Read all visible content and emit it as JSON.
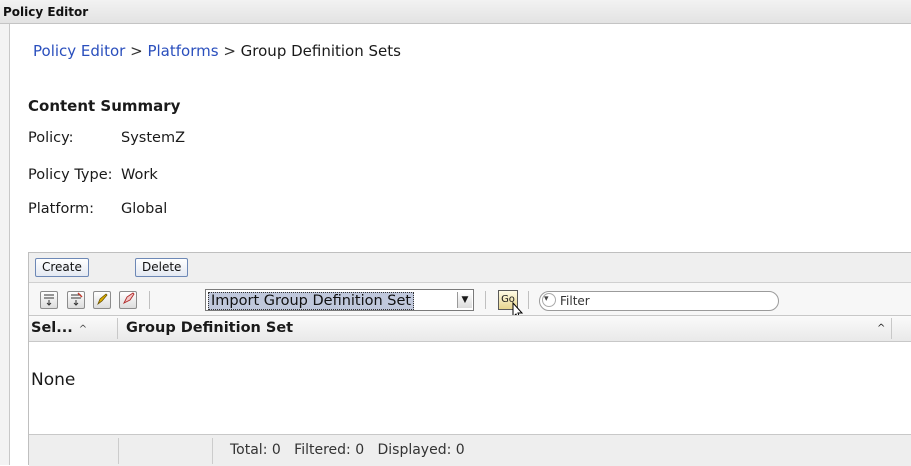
{
  "window": {
    "title": "Policy Editor"
  },
  "breadcrumb": {
    "items": [
      "Policy Editor",
      "Platforms",
      "Group Definition Sets"
    ],
    "separator": ">"
  },
  "summary": {
    "heading": "Content Summary",
    "rows": [
      {
        "label": "Policy:",
        "value": "SystemZ"
      },
      {
        "label": "Policy Type:",
        "value": "Work"
      },
      {
        "label": "Platform:",
        "value": "Global"
      }
    ]
  },
  "toolbar": {
    "create_label": "Create",
    "delete_label": "Delete",
    "action_select": {
      "selected": "Import Group Definition Set"
    },
    "go_label": "Go",
    "filter": {
      "placeholder": "Filter"
    }
  },
  "table": {
    "columns": [
      {
        "label": "Sel..."
      },
      {
        "label": "Group Definition Set"
      }
    ],
    "empty_text": "None",
    "footer": {
      "total_label": "Total:",
      "total": "0",
      "filtered_label": "Filtered:",
      "filtered": "0",
      "displayed_label": "Displayed:",
      "displayed": "0"
    }
  },
  "icons": {
    "toolbar": [
      "expand-all-icon",
      "collapse-all-icon",
      "edit-sort-icon",
      "clear-sort-icon"
    ]
  },
  "colors": {
    "link": "#2a4fbd",
    "button_border": "#6d88b6",
    "selection": "#c0c8dc"
  }
}
